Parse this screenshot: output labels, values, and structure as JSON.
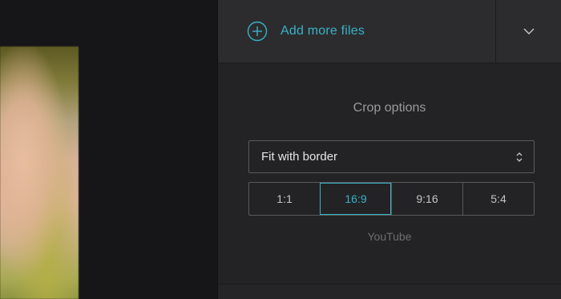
{
  "header": {
    "add_files_label": "Add more files",
    "add_icon": "plus-circle-icon",
    "dropdown_icon": "chevron-down-icon"
  },
  "crop": {
    "title": "Crop options",
    "mode_select": {
      "value": "Fit with border",
      "icon": "select-arrows-icon"
    },
    "ratios": [
      {
        "label": "1:1",
        "active": false
      },
      {
        "label": "16:9",
        "active": true
      },
      {
        "label": "9:16",
        "active": false
      },
      {
        "label": "5:4",
        "active": false
      }
    ],
    "ratio_caption": "YouTube"
  },
  "colors": {
    "accent": "#38b2c8",
    "panel_bg": "#232325",
    "topbar_bg": "#2c2c2e",
    "preview_bg": "#161618"
  }
}
